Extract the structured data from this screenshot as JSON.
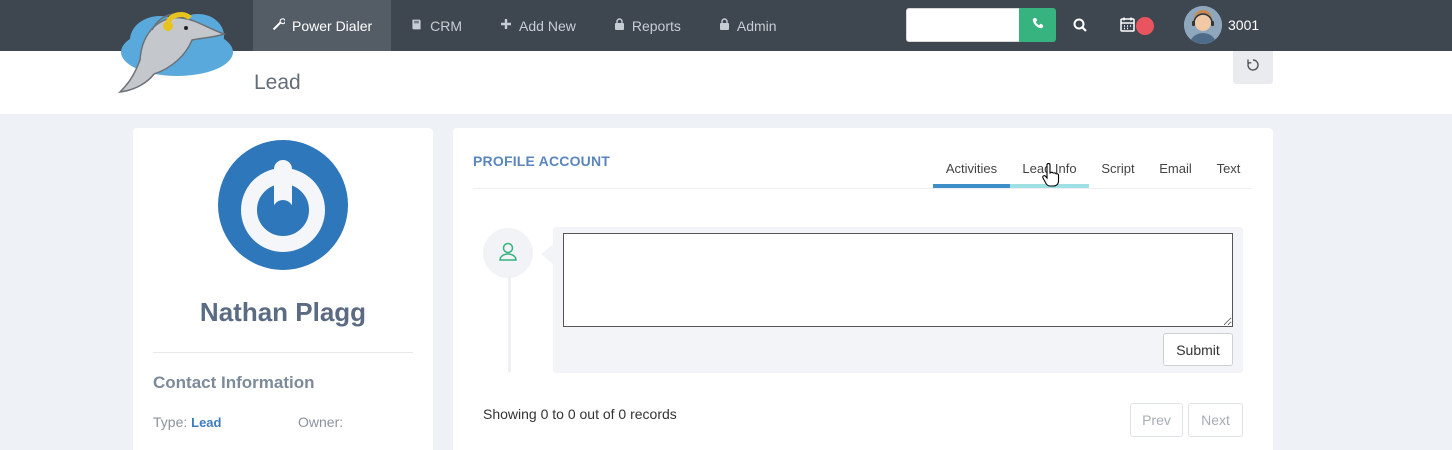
{
  "nav": {
    "items": [
      {
        "label": "Power Dialer",
        "icon": "wrench-icon",
        "active": true
      },
      {
        "label": "CRM",
        "icon": "book-icon",
        "active": false
      },
      {
        "label": "Add New",
        "icon": "plus-icon",
        "active": false
      },
      {
        "label": "Reports",
        "icon": "lock-icon",
        "active": false
      },
      {
        "label": "Admin",
        "icon": "lock-icon",
        "active": false
      }
    ],
    "search_value": "",
    "user_extension": "3001"
  },
  "header": {
    "title": "Lead"
  },
  "lead": {
    "name": "Nathan Plagg",
    "contact_title": "Contact Information",
    "type_label": "Type:",
    "type_value": "Lead",
    "owner_label": "Owner:"
  },
  "profile": {
    "title": "PROFILE ACCOUNT",
    "tabs": [
      "Activities",
      "Lead Info",
      "Script",
      "Email",
      "Text"
    ],
    "active_tab": "Activities",
    "hovered_tab": "Lead Info",
    "comment_value": "",
    "submit_label": "Submit",
    "records_text": "Showing 0 to 0 out of 0 records",
    "prev_label": "Prev",
    "next_label": "Next"
  },
  "colors": {
    "topbar": "#3e4650",
    "accent_green": "#36b37e",
    "tab_active": "#3e8ec9",
    "tab_hover": "#9fe0e4",
    "lead_blue": "#2e77bb",
    "badge_red": "#e8555e"
  }
}
